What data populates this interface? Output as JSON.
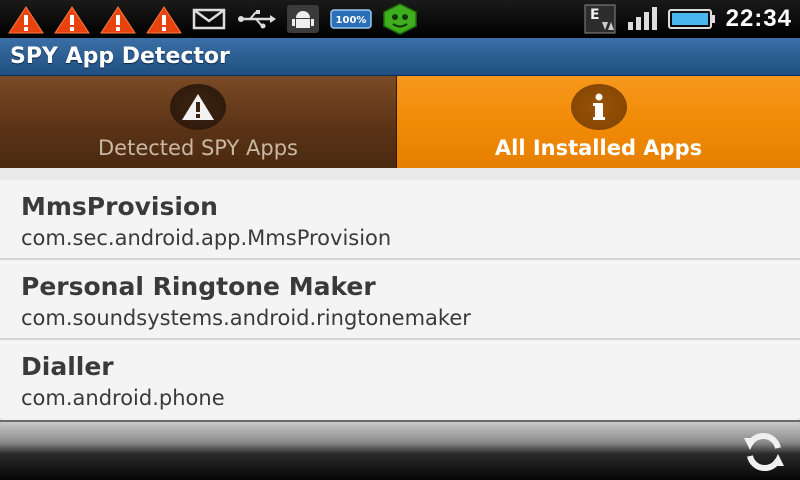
{
  "status_bar": {
    "icons": [
      "warning-icon",
      "warning-icon",
      "warning-icon",
      "warning-icon",
      "mail-icon",
      "usb-icon",
      "android-debug-icon",
      "battery-saver-icon",
      "security-app-icon"
    ],
    "network_label": "E",
    "clock": "22:34"
  },
  "app": {
    "title": "SPY App Detector"
  },
  "tabs": [
    {
      "label": "Detected SPY Apps",
      "icon": "warning-icon",
      "selected": false
    },
    {
      "label": "All Installed Apps",
      "icon": "info-icon",
      "selected": true
    }
  ],
  "apps": [
    {
      "name": "MmsProvision",
      "package": "com.sec.android.app.MmsProvision"
    },
    {
      "name": "Personal Ringtone Maker",
      "package": "com.soundsystems.android.ringtonemaker"
    },
    {
      "name": "Dialler",
      "package": "com.android.phone"
    }
  ],
  "bottom_bar": {
    "refresh_icon": "refresh-icon"
  },
  "colors": {
    "title_bar": "#2a5d93",
    "tab_active": "#f18a05",
    "tab_inactive": "#5c3417",
    "list_bg": "#f4f4f4"
  }
}
